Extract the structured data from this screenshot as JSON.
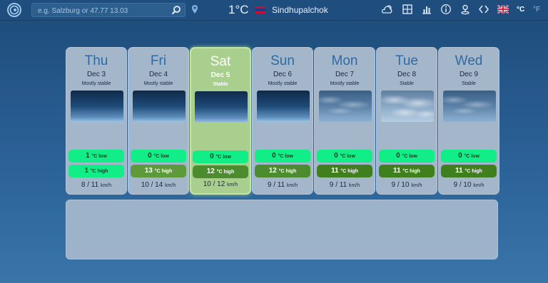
{
  "search": {
    "placeholder": "e.g. Salzburg or 47.77 13.03"
  },
  "header": {
    "temperature": "1°C",
    "location": "Sindhupalchok"
  },
  "units": {
    "celsius": "°C",
    "fahrenheit": "°F"
  },
  "icons": [
    "swirl-logo-icon",
    "search-icon",
    "location-pin-icon",
    "nepal-flag-icon",
    "weather-icon",
    "grid-icon",
    "chart-icon",
    "info-icon",
    "user-location-icon",
    "code-icon",
    "uk-flag-icon"
  ],
  "colors": {
    "accent": "#2f6aa2",
    "low_pill": "#11ee88",
    "selected_card": "#a9cf8e"
  },
  "days": [
    {
      "day": "Thu",
      "date": "Dec 3",
      "condition": "Mostly stable",
      "low": "1",
      "low_unit": "°C low",
      "high": "1",
      "high_unit": "°C high",
      "wind": "8 / 11",
      "wind_unit": "km/h"
    },
    {
      "day": "Fri",
      "date": "Dec 4",
      "condition": "Mostly stable",
      "low": "0",
      "low_unit": "°C low",
      "high": "13",
      "high_unit": "°C high",
      "wind": "10 / 14",
      "wind_unit": "km/h"
    },
    {
      "day": "Sat",
      "date": "Dec 5",
      "condition": "Stable",
      "low": "0",
      "low_unit": "°C low",
      "high": "12",
      "high_unit": "°C high",
      "wind": "10 / 12",
      "wind_unit": "km/h"
    },
    {
      "day": "Sun",
      "date": "Dec 6",
      "condition": "Mostly stable",
      "low": "0",
      "low_unit": "°C low",
      "high": "12",
      "high_unit": "°C high",
      "wind": "9 / 11",
      "wind_unit": "km/h"
    },
    {
      "day": "Mon",
      "date": "Dec 7",
      "condition": "Mostly stable",
      "low": "0",
      "low_unit": "°C low",
      "high": "11",
      "high_unit": "°C high",
      "wind": "9 / 11",
      "wind_unit": "km/h"
    },
    {
      "day": "Tue",
      "date": "Dec 8",
      "condition": "Stable",
      "low": "0",
      "low_unit": "°C low",
      "high": "11",
      "high_unit": "°C high",
      "wind": "9 / 10",
      "wind_unit": "km/h"
    },
    {
      "day": "Wed",
      "date": "Dec 9",
      "condition": "Stable",
      "low": "0",
      "low_unit": "°C low",
      "high": "11",
      "high_unit": "°C high",
      "wind": "9 / 10",
      "wind_unit": "km/h"
    }
  ]
}
